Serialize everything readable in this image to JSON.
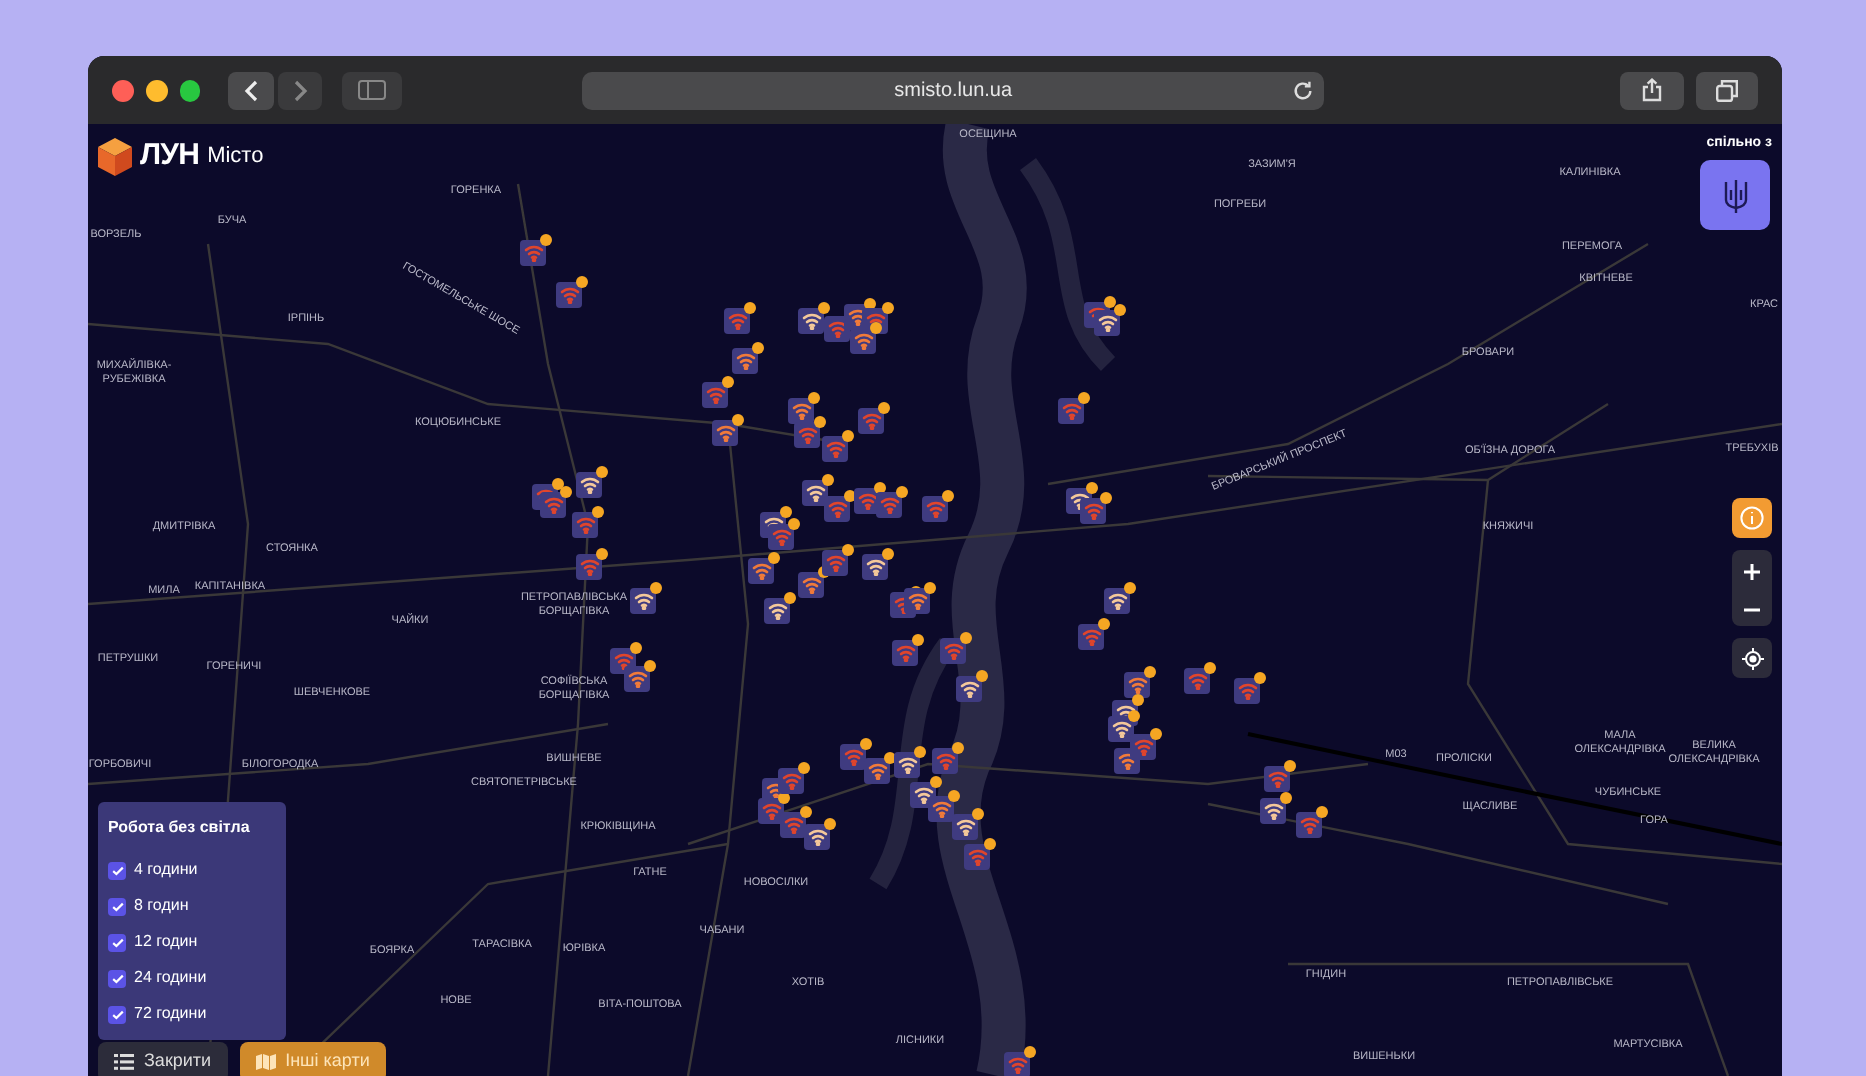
{
  "browser": {
    "url": "smisto.lun.ua"
  },
  "header": {
    "logo_text": "ЛУН",
    "logo_subtitle": "Місто",
    "partner_label": "спільно з"
  },
  "map_labels": [
    {
      "text": "ОСЕЩИНА"
    },
    {
      "text": "ГОРЕНКА"
    },
    {
      "text": "ЗАЗИМ'Я"
    },
    {
      "text": "ПОГРЕБИ"
    },
    {
      "text": "КАЛИНІВКА"
    },
    {
      "text": "ВОРЗЕЛЬ"
    },
    {
      "text": "БУЧА"
    },
    {
      "text": "ПЕРЕМОГА"
    },
    {
      "text": "КВІТНЕВЕ"
    },
    {
      "text": "КРАС"
    },
    {
      "text": "ГОСТОМЕЛЬСЬКЕ ШОСЕ"
    },
    {
      "text": "ІРПІНЬ"
    },
    {
      "text": "МИХАЙЛІВКА- РУБЕЖІВКА"
    },
    {
      "text": "КОЦЮБИНСЬКЕ"
    },
    {
      "text": "БРОВАРИ"
    },
    {
      "text": "ОБ'ЇЗНА ДОРОГА"
    },
    {
      "text": "ТРЕБУХІВ"
    },
    {
      "text": "БРОВАРСЬКИЙ ПРОСПЕКТ"
    },
    {
      "text": "ДМИТРІВКА"
    },
    {
      "text": "СТОЯНКА"
    },
    {
      "text": "КНЯЖИЧІ"
    },
    {
      "text": "МИЛА"
    },
    {
      "text": "КАПІТАНІВКА"
    },
    {
      "text": "ПЕТРОПАВЛІВСЬКА БОРЩАГІВКА"
    },
    {
      "text": "ЧАЙКИ"
    },
    {
      "text": "ПЕТРУШКИ"
    },
    {
      "text": "ГОРЕНИЧІ"
    },
    {
      "text": "ШЕВЧЕНКОВЕ"
    },
    {
      "text": "СОФІЇВСЬКА БОРЩАГІВКА"
    },
    {
      "text": "ГОРБОВИЧІ"
    },
    {
      "text": "БІЛОГОРОДКА"
    },
    {
      "text": "ВИШНЕВЕ"
    },
    {
      "text": "М03"
    },
    {
      "text": "ПРОЛІСКИ"
    },
    {
      "text": "МАЛА ОЛЕКСАНДРІВКА"
    },
    {
      "text": "ВЕЛИКА ОЛЕКСАНДРІВКА"
    },
    {
      "text": "СВЯТОПЕТРІВСЬКЕ"
    },
    {
      "text": "ЧУБИНСЬКЕ"
    },
    {
      "text": "ЩАСЛИВЕ"
    },
    {
      "text": "ГОРА"
    },
    {
      "text": "КРЮКІВЩИНА"
    },
    {
      "text": "ГАТНЕ"
    },
    {
      "text": "НОВОСІЛКИ"
    },
    {
      "text": "ЧАБАНИ"
    },
    {
      "text": "БОЯРКА"
    },
    {
      "text": "ТАРАСІВКА"
    },
    {
      "text": "ЮРІВКА"
    },
    {
      "text": "ХОТІВ"
    },
    {
      "text": "ГНІДИН"
    },
    {
      "text": "ПЕТРОПАВЛІВСЬКЕ"
    },
    {
      "text": "НОВЕ"
    },
    {
      "text": "ВІТА-ПОШТОВА"
    },
    {
      "text": "ЛІСНИКИ"
    },
    {
      "text": "ВИШЕНЬКИ"
    },
    {
      "text": "МАРТУСІВКА"
    }
  ],
  "markers": [
    {
      "color": "#e0452c"
    },
    {
      "color": "#e0452c"
    },
    {
      "color": "#e0452c"
    },
    {
      "color": "#f07a3a"
    },
    {
      "color": "#e0452c"
    },
    {
      "color": "#f07a3a"
    },
    {
      "color": "#f4c89a"
    },
    {
      "color": "#e0452c"
    },
    {
      "color": "#f07a3a"
    },
    {
      "color": "#e0452c"
    },
    {
      "color": "#f07a3a"
    },
    {
      "color": "#f07a3a"
    },
    {
      "color": "#e0452c"
    },
    {
      "color": "#e0452c"
    },
    {
      "color": "#e0452c"
    },
    {
      "color": "#e0452c"
    },
    {
      "color": "#f4c89a"
    },
    {
      "color": "#e0452c"
    },
    {
      "color": "#e0452c"
    },
    {
      "color": "#f4c89a"
    },
    {
      "color": "#e0452c"
    },
    {
      "color": "#e0452c"
    },
    {
      "color": "#e0452c"
    },
    {
      "color": "#f4c89a"
    },
    {
      "color": "#e0452c"
    },
    {
      "color": "#f07a3a"
    },
    {
      "color": "#f4c89a"
    },
    {
      "color": "#e0452c"
    },
    {
      "color": "#f4c89a"
    },
    {
      "color": "#e0452c"
    },
    {
      "color": "#e0452c"
    },
    {
      "color": "#e0452c"
    },
    {
      "color": "#e0452c"
    },
    {
      "color": "#f07a3a"
    },
    {
      "color": "#f4c89a"
    },
    {
      "color": "#f07a3a"
    },
    {
      "color": "#e0452c"
    },
    {
      "color": "#f4c89a"
    },
    {
      "color": "#e0452c"
    },
    {
      "color": "#f07a3a"
    },
    {
      "color": "#e0452c"
    },
    {
      "color": "#e0452c"
    },
    {
      "color": "#f4c89a"
    },
    {
      "color": "#e0452c"
    },
    {
      "color": "#f4c89a"
    },
    {
      "color": "#f4c89a"
    },
    {
      "color": "#e0452c"
    },
    {
      "color": "#f07a3a"
    },
    {
      "color": "#f4c89a"
    },
    {
      "color": "#e0452c"
    },
    {
      "color": "#e0452c"
    },
    {
      "color": "#f4c89a"
    },
    {
      "color": "#f07a3a"
    },
    {
      "color": "#e0452c"
    },
    {
      "color": "#e0452c"
    },
    {
      "color": "#f4c89a"
    },
    {
      "color": "#e0452c"
    },
    {
      "color": "#e0452c"
    },
    {
      "color": "#f07a3a"
    },
    {
      "color": "#f4c89a"
    },
    {
      "color": "#e0452c"
    },
    {
      "color": "#f4c89a"
    },
    {
      "color": "#f07a3a"
    },
    {
      "color": "#f4c89a"
    },
    {
      "color": "#e0452c"
    },
    {
      "color": "#f07a3a"
    },
    {
      "color": "#e0452c"
    },
    {
      "color": "#e0452c"
    },
    {
      "color": "#e0452c"
    },
    {
      "color": "#f4c89a"
    },
    {
      "color": "#e0452c"
    }
  ],
  "legend": {
    "title": "Робота без світла",
    "items": [
      {
        "label": "4 години",
        "checked": true
      },
      {
        "label": "8 годин",
        "checked": true
      },
      {
        "label": "12 годин",
        "checked": true
      },
      {
        "label": "24 години",
        "checked": true
      },
      {
        "label": "72 години",
        "checked": true
      }
    ]
  },
  "buttons": [
    {
      "label": "Закрити",
      "kind": "list"
    },
    {
      "label": "Інші карти",
      "kind": "maps"
    }
  ]
}
